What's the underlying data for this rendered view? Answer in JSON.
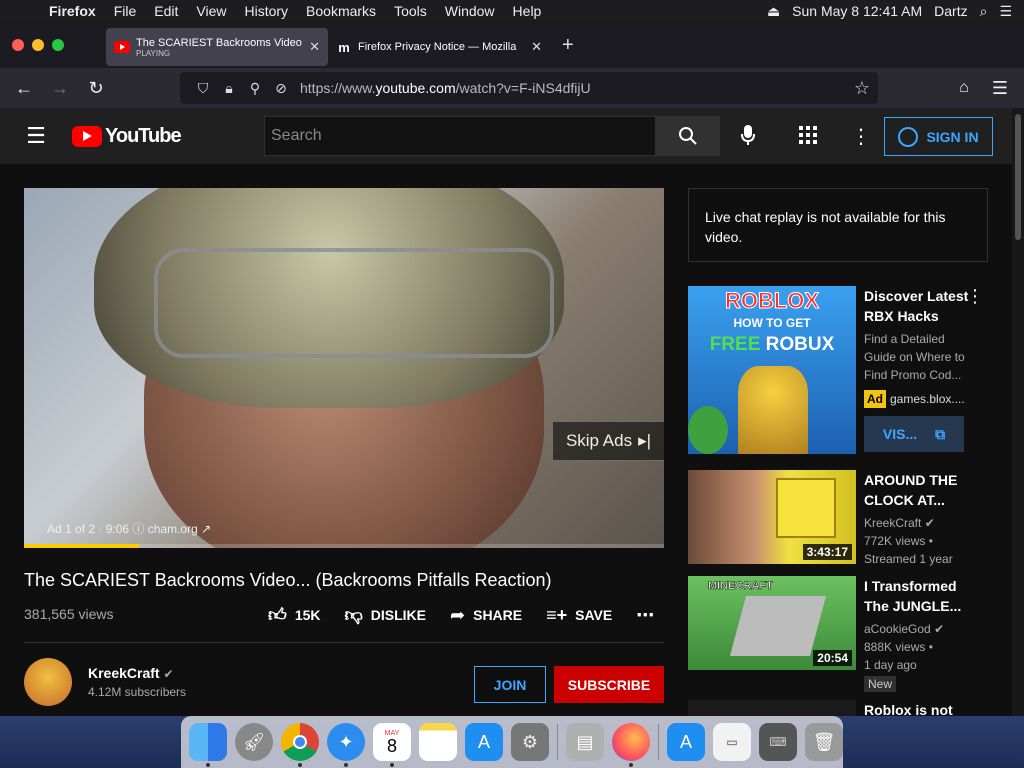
{
  "menubar": {
    "app": "Firefox",
    "items": [
      "File",
      "Edit",
      "View",
      "History",
      "Bookmarks",
      "Tools",
      "Window",
      "Help"
    ],
    "clock": "Sun May 8  12:41 AM",
    "user": "Dartz"
  },
  "tabs": [
    {
      "title": "The SCARIEST Backrooms Video",
      "subtitle": "PLAYING"
    },
    {
      "title": "Firefox Privacy Notice — Mozilla",
      "subtitle": ""
    }
  ],
  "url": {
    "prefix": "https://www.",
    "domain": "youtube.com",
    "path": "/watch?v=F-iNS4dfijU"
  },
  "header": {
    "logo_text": "YouTube",
    "search_placeholder": "Search",
    "signin_label": "SIGN IN"
  },
  "video": {
    "skip_label": "Skip Ads",
    "ad_info": "Ad 1 of 2 · 9:06",
    "ad_domain": "cham.org",
    "progress": 0.18,
    "title": "The SCARIEST Backrooms Video... (Backrooms Pitfalls Reaction)",
    "views": "381,565 views",
    "likes": "15K",
    "dislike_label": "DISLIKE",
    "share_label": "SHARE",
    "save_label": "SAVE"
  },
  "channel": {
    "name": "KreekCraft",
    "subscribers": "4.12M subscribers",
    "join_label": "JOIN",
    "subscribe_label": "SUBSCRIBE"
  },
  "chat": {
    "message": "Live chat replay is not available for this video."
  },
  "ad_card": {
    "thumb_line1": "ROBLOX",
    "thumb_line2": "HOW TO GET",
    "thumb_line3": "FREE",
    "thumb_line4": "ROBUX",
    "title": "Discover Latest RBX Hacks",
    "description": "Find a Detailed Guide on Where to Find Promo Cod...",
    "badge": "Ad",
    "domain": "games.blox....",
    "visit_label": "VIS..."
  },
  "recommendations": [
    {
      "title": "AROUND THE CLOCK AT...",
      "channel": "KreekCraft",
      "meta": "772K views •",
      "meta2": "Streamed 1 year",
      "duration": "3:43:17",
      "badge": ""
    },
    {
      "title": "I Transformed The JUNGLE...",
      "channel": "aCookieGod",
      "meta": "888K views •",
      "meta2": "1 day ago",
      "duration": "20:54",
      "badge": "New",
      "thumb_text": "MINECRAFT"
    },
    {
      "title": "Roblox is not"
    }
  ],
  "dock": {
    "calendar_month": "MAY",
    "calendar_day": "8"
  },
  "colors": {
    "accent": "#3ea6ff",
    "youtube_red": "#ff0000",
    "subscribe": "#cc0000",
    "ad_progress": "#ffcc00"
  }
}
